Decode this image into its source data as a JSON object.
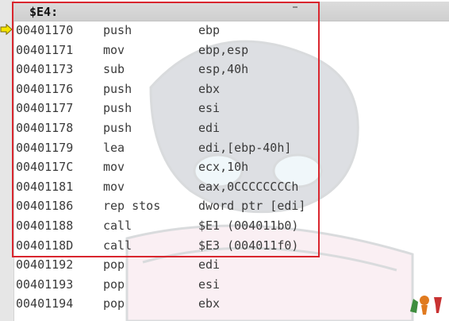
{
  "header": {
    "label": "$E4:"
  },
  "pointer": {
    "icon": "arrow-right-icon",
    "color": "#f5e400"
  },
  "selection": {
    "color": "#d9262e"
  },
  "rows": [
    {
      "addr": "00401170",
      "mnem": "push",
      "oper": "ebp"
    },
    {
      "addr": "00401171",
      "mnem": "mov",
      "oper": "ebp,esp"
    },
    {
      "addr": "00401173",
      "mnem": "sub",
      "oper": "esp,40h"
    },
    {
      "addr": "00401176",
      "mnem": "push",
      "oper": "ebx"
    },
    {
      "addr": "00401177",
      "mnem": "push",
      "oper": "esi"
    },
    {
      "addr": "00401178",
      "mnem": "push",
      "oper": "edi"
    },
    {
      "addr": "00401179",
      "mnem": "lea",
      "oper": "edi,[ebp-40h]"
    },
    {
      "addr": "0040117C",
      "mnem": "mov",
      "oper": "ecx,10h"
    },
    {
      "addr": "00401181",
      "mnem": "mov",
      "oper": "eax,0CCCCCCCCh"
    },
    {
      "addr": "00401186",
      "mnem": "rep stos",
      "oper": "dword ptr [edi]"
    },
    {
      "addr": "00401188",
      "mnem": "call",
      "oper": "$E1 (004011b0)"
    },
    {
      "addr": "0040118D",
      "mnem": "call",
      "oper": "$E3 (004011f0)"
    },
    {
      "addr": "00401192",
      "mnem": "pop",
      "oper": "edi"
    },
    {
      "addr": "00401193",
      "mnem": "pop",
      "oper": "esi"
    },
    {
      "addr": "00401194",
      "mnem": "pop",
      "oper": "ebx"
    }
  ]
}
